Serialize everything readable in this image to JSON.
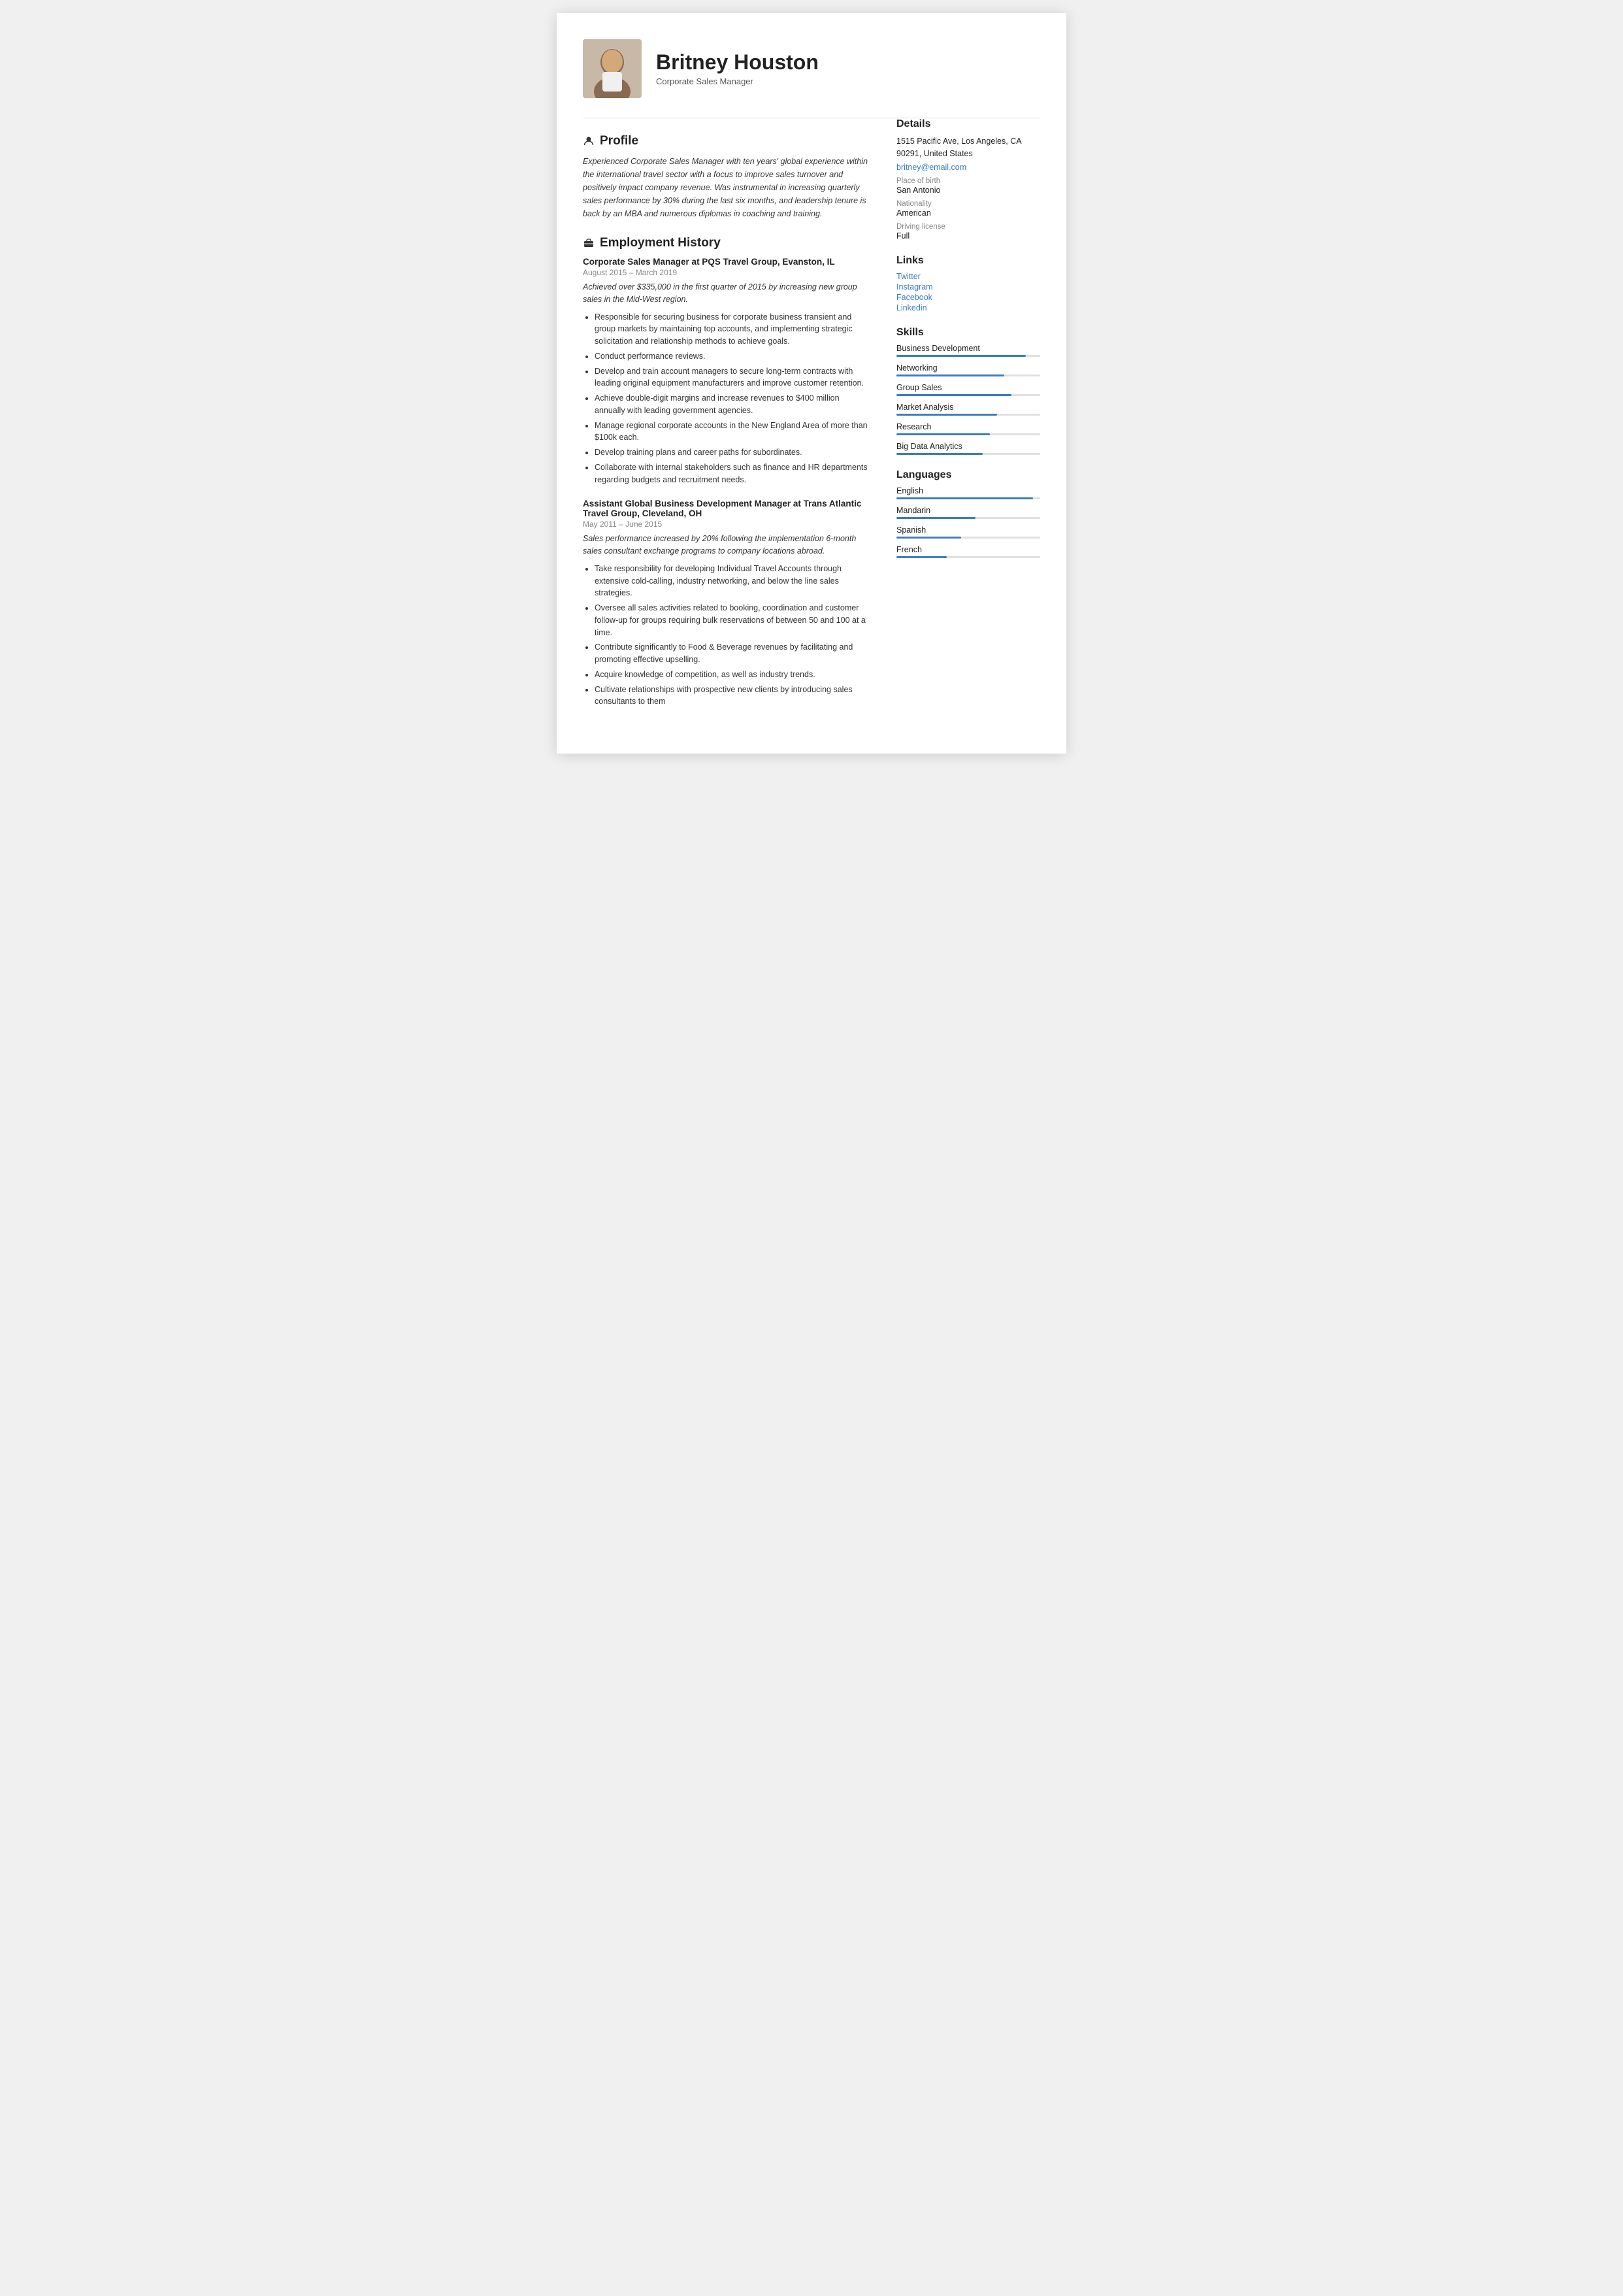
{
  "header": {
    "name": "Britney Houston",
    "title": "Corporate Sales Manager",
    "avatar_alt": "Britney Houston photo"
  },
  "profile": {
    "section_label": "Profile",
    "text": "Experienced Corporate Sales Manager with ten years' global experience within the international travel sector with a focus to improve sales turnover and positively impact company revenue. Was instrumental in increasing quarterly sales performance by 30% during the last six months, and leadership tenure is back by an MBA and numerous diplomas in coaching and training."
  },
  "employment": {
    "section_label": "Employment History",
    "jobs": [
      {
        "title": "Corporate Sales Manager at PQS Travel Group, Evanston, IL",
        "dates": "August 2015 – March 2019",
        "summary": "Achieved over $335,000 in the first quarter of 2015 by increasing new group sales in the Mid-West region.",
        "bullets": [
          "Responsible for securing business for corporate business transient and group markets by maintaining top accounts, and implementing strategic solicitation and relationship methods to achieve goals.",
          "Conduct performance reviews.",
          "Develop and train account managers to secure long-term contracts with leading original equipment manufacturers and improve customer retention.",
          "Achieve double-digit margins and increase revenues to $400 million annually with leading government agencies.",
          "Manage regional corporate accounts in the New England Area of more than $100k each.",
          "Develop training plans and career paths for subordinates.",
          "Collaborate with internal stakeholders such as finance and HR departments regarding budgets and recruitment needs."
        ]
      },
      {
        "title": "Assistant Global Business Development Manager at Trans Atlantic Travel Group, Cleveland, OH",
        "dates": "May 2011 – June 2015",
        "summary": "Sales performance increased by 20% following the implementation 6-month sales consultant exchange programs to company locations abroad.",
        "bullets": [
          "Take responsibility for developing Individual Travel Accounts through extensive cold-calling, industry networking, and below the line sales strategies.",
          "Oversee all sales activities related to booking, coordination and customer follow-up for groups requiring bulk reservations of between 50 and 100 at a time.",
          "Contribute significantly to Food & Beverage revenues by facilitating and promoting effective upselling.",
          "Acquire knowledge of competition, as well as industry trends.",
          "Cultivate relationships with prospective new clients by introducing sales consultants to them"
        ]
      }
    ]
  },
  "details": {
    "section_label": "Details",
    "address": "1515 Pacific Ave, Los Angeles, CA 90291, United States",
    "email": "britney@email.com",
    "place_of_birth_label": "Place of birth",
    "place_of_birth": "San Antonio",
    "nationality_label": "Nationality",
    "nationality": "American",
    "driving_license_label": "Driving license",
    "driving_license": "Full"
  },
  "links": {
    "section_label": "Links",
    "items": [
      {
        "label": "Twitter",
        "url": "#"
      },
      {
        "label": "Instagram",
        "url": "#"
      },
      {
        "label": "Facebook",
        "url": "#"
      },
      {
        "label": "Linkedin",
        "url": "#"
      }
    ]
  },
  "skills": {
    "section_label": "Skills",
    "items": [
      {
        "name": "Business Development",
        "percent": 90
      },
      {
        "name": "Networking",
        "percent": 75
      },
      {
        "name": "Group Sales",
        "percent": 80
      },
      {
        "name": "Market Analysis",
        "percent": 70
      },
      {
        "name": "Research",
        "percent": 65
      },
      {
        "name": "Big Data Analytics",
        "percent": 60
      }
    ]
  },
  "languages": {
    "section_label": "Languages",
    "items": [
      {
        "name": "English",
        "percent": 95
      },
      {
        "name": "Mandarin",
        "percent": 55
      },
      {
        "name": "Spanish",
        "percent": 45
      },
      {
        "name": "French",
        "percent": 35
      }
    ]
  },
  "icons": {
    "profile": "👤",
    "briefcase": "💼"
  }
}
